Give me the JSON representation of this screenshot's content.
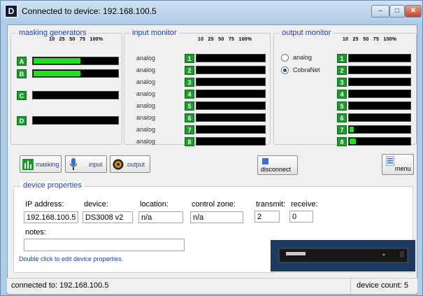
{
  "window": {
    "title": "Connected to device: 192.168.100.5",
    "app_icon": "D",
    "min": "–",
    "max": "□",
    "close": "✕"
  },
  "scale": "10   25   50   75   100%",
  "masking": {
    "title": "masking generators",
    "channels": [
      {
        "label": "A",
        "level": 0.56
      },
      {
        "label": "B",
        "level": 0.56
      },
      {
        "label": "C",
        "level": 0.0
      },
      {
        "label": "D",
        "level": 0.0
      }
    ]
  },
  "input_monitor": {
    "title": "input monitor",
    "channels": [
      {
        "source": "analog",
        "label": "1",
        "level": 0.0
      },
      {
        "source": "analog",
        "label": "2",
        "level": 0.0
      },
      {
        "source": "analog",
        "label": "3",
        "level": 0.0
      },
      {
        "source": "analog",
        "label": "4",
        "level": 0.0
      },
      {
        "source": "analog",
        "label": "5",
        "level": 0.0
      },
      {
        "source": "analog",
        "label": "6",
        "level": 0.0
      },
      {
        "source": "analog",
        "label": "7",
        "level": 0.0
      },
      {
        "source": "analog",
        "label": "8",
        "level": 0.0
      }
    ]
  },
  "output_monitor": {
    "title": "output monitor",
    "options": [
      {
        "label": "analog",
        "selected": false
      },
      {
        "label": "CobraNet",
        "selected": true
      }
    ],
    "channels": [
      {
        "label": "1",
        "level": 0.0
      },
      {
        "label": "2",
        "level": 0.0
      },
      {
        "label": "3",
        "level": 0.0
      },
      {
        "label": "4",
        "level": 0.0
      },
      {
        "label": "5",
        "level": 0.0
      },
      {
        "label": "6",
        "level": 0.0
      },
      {
        "label": "7",
        "level": 0.07
      },
      {
        "label": "8",
        "level": 0.1
      }
    ]
  },
  "toolbar": {
    "masking": "masking",
    "input": "input",
    "output": "output",
    "disconnect": "disconnect",
    "menu": "menu"
  },
  "device_properties": {
    "title": "device properties",
    "ip_label": "IP address:",
    "ip": "192.168.100.5",
    "device_label": "device:",
    "device": "DS3008 v2",
    "location_label": "location:",
    "location": "n/a",
    "zone_label": "control zone:",
    "zone": "n/a",
    "transmit_label": "transmit:",
    "transmit": "2",
    "receive_label": "receive:",
    "receive": "0",
    "notes_label": "notes:",
    "notes": "",
    "hint": "Double click to edit device properties."
  },
  "status": {
    "connected": "connected to:  192.168.100.5",
    "count": "device count: 5"
  },
  "colors": {
    "accent": "#1e3fa8",
    "meter_fill": "#20e020",
    "channel_badge": "#1c9a2c"
  }
}
